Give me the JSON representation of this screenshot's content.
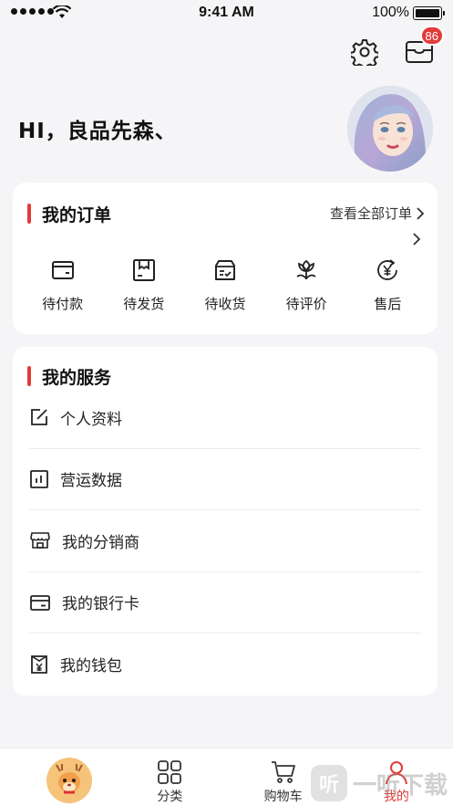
{
  "status_bar": {
    "time": "9:41 AM",
    "battery": "100%"
  },
  "header": {
    "settings_icon": "gear-icon",
    "messages_icon": "inbox-icon",
    "messages_badge": "86",
    "greeting": "HI，良品先森、"
  },
  "orders": {
    "title": "我的订单",
    "view_all": "查看全部订单",
    "items": [
      {
        "label": "待付款",
        "icon": "wallet-icon"
      },
      {
        "label": "待发货",
        "icon": "package-icon"
      },
      {
        "label": "待收货",
        "icon": "receive-box-icon"
      },
      {
        "label": "待评价",
        "icon": "flower-review-icon"
      },
      {
        "label": "售后",
        "icon": "yen-refund-icon"
      }
    ]
  },
  "services": {
    "title": "我的服务",
    "items": [
      {
        "label": "个人资料",
        "icon": "edit-icon"
      },
      {
        "label": "营运数据",
        "icon": "bar-chart-icon"
      },
      {
        "label": "我的分销商",
        "icon": "store-icon"
      },
      {
        "label": "我的银行卡",
        "icon": "bank-card-icon"
      },
      {
        "label": "我的钱包",
        "icon": "wallet-yen-icon"
      }
    ]
  },
  "tabbar": {
    "tabs": [
      {
        "label": "",
        "icon": "home-logo-icon"
      },
      {
        "label": "分类",
        "icon": "grid-icon"
      },
      {
        "label": "购物车",
        "icon": "cart-icon"
      },
      {
        "label": "我的",
        "icon": "user-icon"
      }
    ],
    "active_color": "#e23b3b"
  },
  "watermark": "一听下载",
  "colors": {
    "accent": "#e23b3b",
    "background": "#f5f5f7"
  }
}
